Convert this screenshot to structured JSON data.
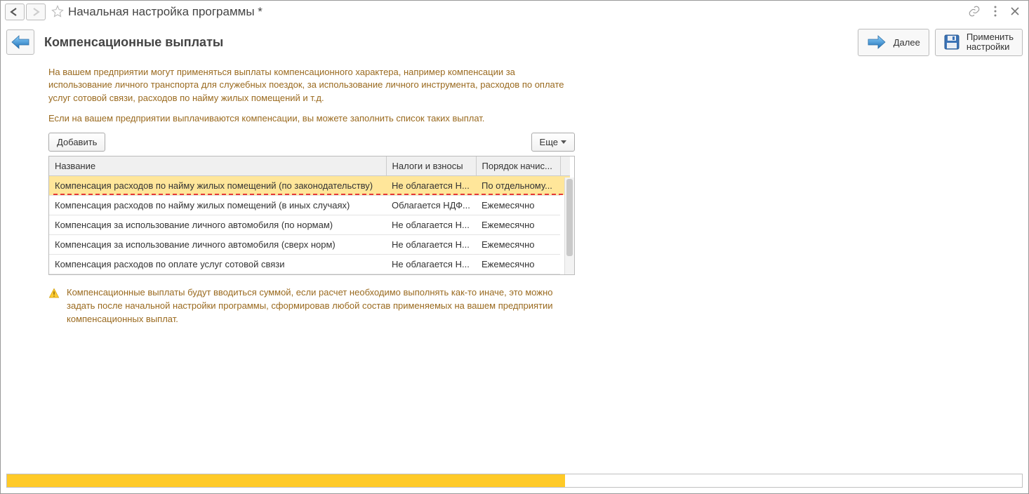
{
  "titlebar": {
    "title": "Начальная настройка программы *"
  },
  "section": {
    "title": "Компенсационные выплаты",
    "next_label": "Далее",
    "apply_line1": "Применить",
    "apply_line2": "настройки"
  },
  "intro": {
    "p1": "На вашем предприятии могут применяться выплаты компенсационного характера, например компенсации за использование личного транспорта для служебных поездок, за использование личного инструмента, расходов по оплате услуг сотовой связи, расходов по найму жилых помещений и т.д.",
    "p2": "Если на вашем предприятии выплачиваются компенсации, вы можете заполнить список таких выплат."
  },
  "toolbar": {
    "add_label": "Добавить",
    "more_label": "Еще"
  },
  "table": {
    "columns": {
      "c1": "Название",
      "c2": "Налоги и взносы",
      "c3": "Порядок начис..."
    },
    "rows": [
      {
        "c1": "Компенсация расходов по найму жилых помещений (по законодательству)",
        "c2": "Не облагается Н...",
        "c3": "По отдельному...",
        "selected": true
      },
      {
        "c1": "Компенсация расходов по найму жилых помещений (в иных случаях)",
        "c2": "Облагается НДФ...",
        "c3": "Ежемесячно",
        "selected": false
      },
      {
        "c1": "Компенсация за использование личного автомобиля (по нормам)",
        "c2": "Не облагается Н...",
        "c3": "Ежемесячно",
        "selected": false
      },
      {
        "c1": "Компенсация за использование личного автомобиля (сверх норм)",
        "c2": "Не облагается Н...",
        "c3": "Ежемесячно",
        "selected": false
      },
      {
        "c1": "Компенсация расходов по оплате услуг сотовой связи",
        "c2": "Не облагается Н...",
        "c3": "Ежемесячно",
        "selected": false
      }
    ]
  },
  "note": {
    "text": "Компенсационные выплаты будут вводиться суммой, если расчет необходимо выполнять как-то иначе, это можно задать после начальной настройки программы, сформировав любой состав применяемых на вашем предприятии компенсационных выплат."
  },
  "progress": {
    "percent": 55
  }
}
